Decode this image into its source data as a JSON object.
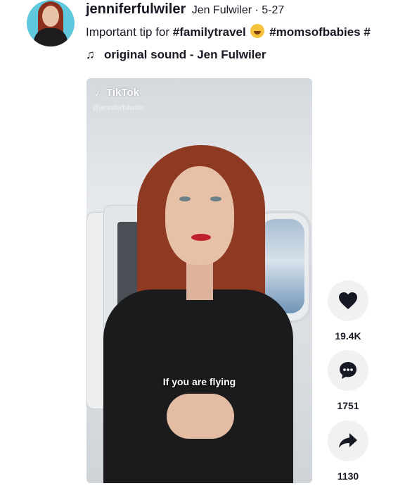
{
  "author": {
    "username": "jenniferfulwiler",
    "nickname_date": "Jen Fulwiler · 5-27"
  },
  "description": {
    "text_prefix": "Important tip for ",
    "tag1": "#familytravel",
    "emoji": "face-with-tears-of-joy-icon",
    "tag2": "#momsofbabies",
    "tag_overflow": " #"
  },
  "sound": {
    "label": "original sound - Jen Fulwiler"
  },
  "video": {
    "watermark_logo": "TikTok",
    "watermark_handle": "@jenniferfulwiler",
    "caption": "If you are flying"
  },
  "actions": {
    "likes": "19.4K",
    "comments": "1751",
    "shares": "1130"
  },
  "colors": {
    "avatar_bg": "#5fc8dd",
    "text": "#161823",
    "action_bg": "#f1f1f2"
  }
}
